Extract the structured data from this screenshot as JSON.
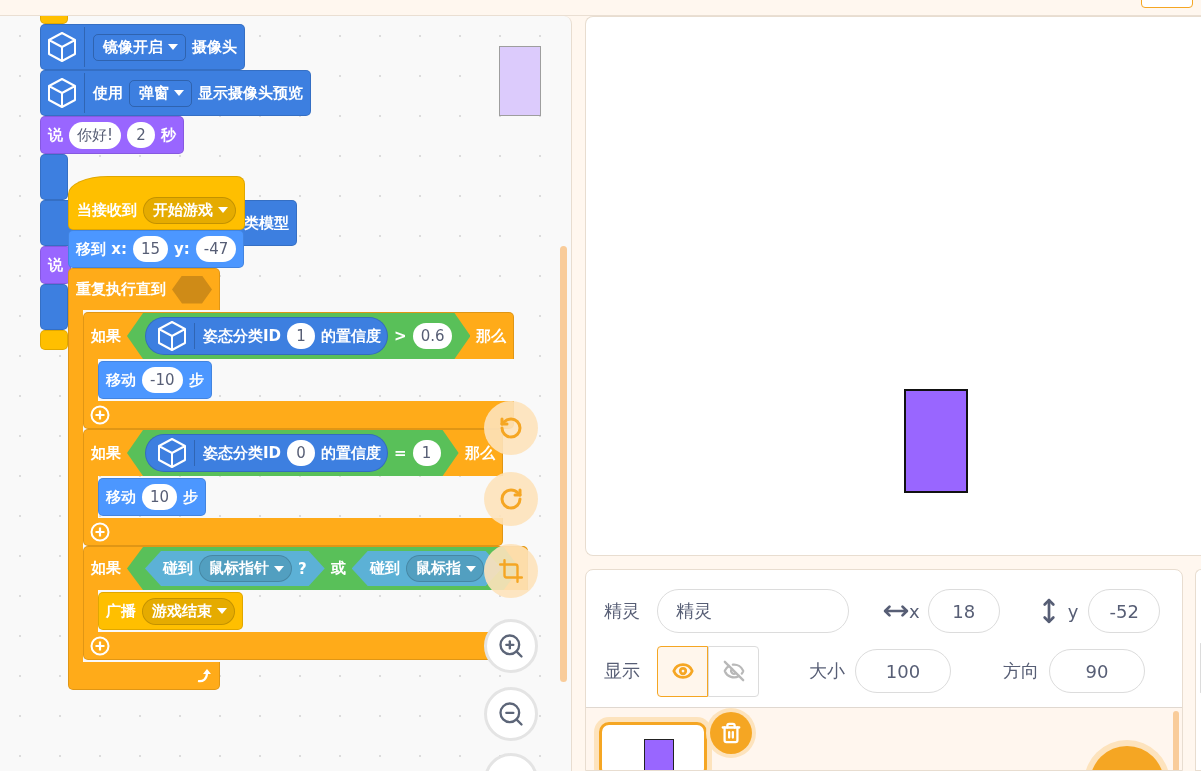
{
  "back_script": [
    {
      "kind": "stack",
      "color": "#ffbf00"
    },
    {
      "kind": "extension",
      "color": "#3d7fe0",
      "parts": [
        {
          "kind": "dropdown",
          "text": "镜像开启"
        },
        {
          "kind": "label",
          "text": "摄像头"
        }
      ]
    },
    {
      "kind": "extension",
      "color": "#3d7fe0",
      "parts": [
        {
          "kind": "label",
          "text": "使用"
        },
        {
          "kind": "dropdown",
          "text": "弹窗"
        },
        {
          "kind": "label",
          "text": "显示摄像头预览"
        }
      ]
    },
    {
      "kind": "stack",
      "color": "#9966ff",
      "parts": [
        {
          "kind": "label",
          "text": "说"
        },
        {
          "kind": "input",
          "text": "你好!"
        },
        {
          "kind": "input",
          "text": "2"
        },
        {
          "kind": "label",
          "text": "秒"
        }
      ]
    },
    {
      "kind": "tall",
      "color": "#3d7fe0"
    },
    {
      "kind": "tall",
      "color": "#3d7fe0",
      "parts": [
        {
          "kind": "covered"
        },
        {
          "kind": "label",
          "text": "类模型"
        }
      ]
    },
    {
      "kind": "stack",
      "color": "#9966ff",
      "parts": [
        {
          "kind": "label",
          "text": "说"
        }
      ]
    },
    {
      "kind": "tall",
      "color": "#3d7fe0"
    },
    {
      "kind": "stack",
      "color": "#ffbf00"
    }
  ],
  "front_script": [
    {
      "kind": "hat",
      "color": "#ffbf00",
      "parts": [
        {
          "kind": "label",
          "text": "当接收到"
        },
        {
          "kind": "dropdown",
          "text": "开始游戏"
        }
      ]
    },
    {
      "kind": "stack",
      "color": "#4c97ff",
      "parts": [
        {
          "kind": "label",
          "text": "移到 x:"
        },
        {
          "kind": "input",
          "text": "15"
        },
        {
          "kind": "label",
          "text": "y:"
        },
        {
          "kind": "input",
          "text": "-47"
        }
      ]
    },
    {
      "kind": "repeat",
      "color": "#ffab19",
      "parts": [
        {
          "kind": "label",
          "text": "重复执行直到"
        },
        {
          "kind": "slot"
        }
      ],
      "body": [
        {
          "kind": "if",
          "color": "#ffab19",
          "parts": [
            {
              "kind": "label",
              "text": "如果"
            },
            {
              "kind": "boolean",
              "color": "#59c059",
              "parts": [
                {
                  "kind": "reporter",
                  "color": "#3d7fe0",
                  "parts": [
                    {
                      "kind": "label",
                      "text": "姿态分类ID"
                    },
                    {
                      "kind": "input",
                      "text": "1"
                    },
                    {
                      "kind": "label",
                      "text": "的置信度"
                    }
                  ]
                },
                {
                  "kind": "label",
                  "text": ">"
                },
                {
                  "kind": "input",
                  "text": "0.6"
                }
              ]
            },
            {
              "kind": "label",
              "text": "那么"
            }
          ],
          "body": [
            {
              "kind": "stack",
              "color": "#4c97ff",
              "parts": [
                {
                  "kind": "label",
                  "text": "移动"
                },
                {
                  "kind": "input",
                  "text": "-10"
                },
                {
                  "kind": "label",
                  "text": "步"
                }
              ]
            }
          ]
        },
        {
          "kind": "if",
          "color": "#ffab19",
          "parts": [
            {
              "kind": "label",
              "text": "如果"
            },
            {
              "kind": "boolean",
              "color": "#59c059",
              "parts": [
                {
                  "kind": "reporter",
                  "color": "#3d7fe0",
                  "parts": [
                    {
                      "kind": "label",
                      "text": "姿态分类ID"
                    },
                    {
                      "kind": "input",
                      "text": "0"
                    },
                    {
                      "kind": "label",
                      "text": "的置信度"
                    }
                  ]
                },
                {
                  "kind": "label",
                  "text": "="
                },
                {
                  "kind": "input",
                  "text": "1"
                }
              ]
            },
            {
              "kind": "label",
              "text": "那么"
            }
          ],
          "body": [
            {
              "kind": "stack",
              "color": "#4c97ff",
              "parts": [
                {
                  "kind": "label",
                  "text": "移动"
                },
                {
                  "kind": "input",
                  "text": "10"
                },
                {
                  "kind": "label",
                  "text": "步"
                }
              ]
            }
          ]
        },
        {
          "kind": "if",
          "color": "#ffab19",
          "parts": [
            {
              "kind": "label",
              "text": "如果"
            },
            {
              "kind": "boolean",
              "color": "#59c059",
              "parts": [
                {
                  "kind": "boolean",
                  "color": "#5cb1d6",
                  "parts": [
                    {
                      "kind": "label",
                      "text": "碰到"
                    },
                    {
                      "kind": "dropdown",
                      "text": "鼠标指针"
                    },
                    {
                      "kind": "label",
                      "text": "?"
                    }
                  ]
                },
                {
                  "kind": "label",
                  "text": "或"
                },
                {
                  "kind": "boolean",
                  "color": "#5cb1d6",
                  "parts": [
                    {
                      "kind": "label",
                      "text": "碰到"
                    },
                    {
                      "kind": "dropdown",
                      "text": "鼠标指"
                    }
                  ]
                }
              ]
            }
          ],
          "body": [
            {
              "kind": "stack",
              "color": "#ffbf00",
              "parts": [
                {
                  "kind": "label",
                  "text": "广播"
                },
                {
                  "kind": "dropdown",
                  "text": "游戏结束"
                }
              ]
            }
          ]
        }
      ]
    }
  ],
  "sprite_info": {
    "name_label": "精灵",
    "name_value": "精灵",
    "x_label": "x",
    "x_value": "18",
    "y_label": "y",
    "y_value": "-52",
    "show_label": "显示",
    "visible": true,
    "size_label": "大小",
    "size_value": "100",
    "direction_label": "方向",
    "direction_value": "90"
  }
}
